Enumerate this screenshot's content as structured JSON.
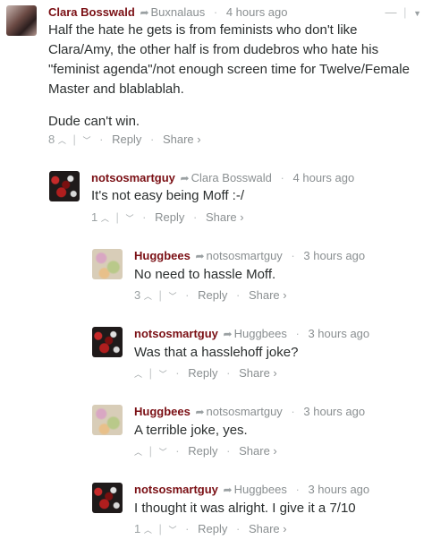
{
  "comments": [
    {
      "author": "Clara Bosswald",
      "reply_to": "Buxnalaus",
      "time": "4 hours ago",
      "body": [
        "Half the hate he gets is from feminists who don't like Clara/Amy, the other half is from dudebros who hate his \"feminist agenda\"/not enough screen time for Twelve/Female Master and blablablah.",
        "Dude can't win."
      ],
      "votes": "8",
      "reply": "Reply",
      "share": "Share"
    },
    {
      "author": "notsosmartguy",
      "reply_to": "Clara Bosswald",
      "time": "4 hours ago",
      "body": [
        "It's not easy being Moff :-/"
      ],
      "votes": "1",
      "reply": "Reply",
      "share": "Share"
    },
    {
      "author": "Huggbees",
      "reply_to": "notsosmartguy",
      "time": "3 hours ago",
      "body": [
        "No need to hassle Moff."
      ],
      "votes": "3",
      "reply": "Reply",
      "share": "Share"
    },
    {
      "author": "notsosmartguy",
      "reply_to": "Huggbees",
      "time": "3 hours ago",
      "body": [
        "Was that a hasslehoff joke?"
      ],
      "votes": "",
      "reply": "Reply",
      "share": "Share"
    },
    {
      "author": "Huggbees",
      "reply_to": "notsosmartguy",
      "time": "3 hours ago",
      "body": [
        "A terrible joke, yes."
      ],
      "votes": "",
      "reply": "Reply",
      "share": "Share"
    },
    {
      "author": "notsosmartguy",
      "reply_to": "Huggbees",
      "time": "3 hours ago",
      "body": [
        "I thought it was alright. I give it a 7/10"
      ],
      "votes": "1",
      "reply": "Reply",
      "share": "Share"
    }
  ],
  "icons": {
    "reply_to": "share-arrow-icon",
    "upvote": "chevron-up-icon",
    "downvote": "chevron-down-icon",
    "collapse": "minus-icon",
    "menu": "chevron-down-icon"
  }
}
